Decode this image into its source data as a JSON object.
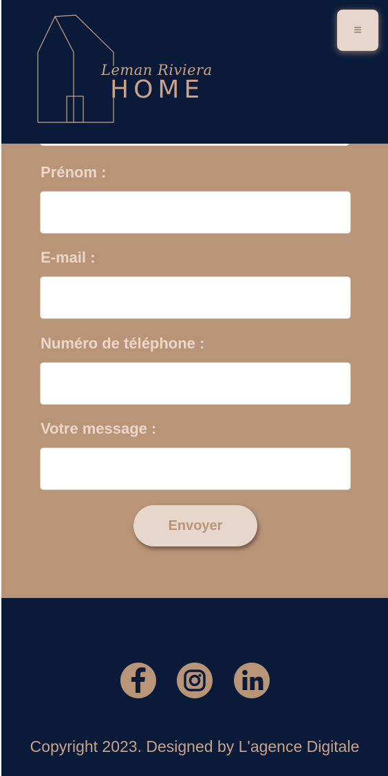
{
  "colors": {
    "navy": "#0a1b3a",
    "tan": "#b99578",
    "cream": "#e6d6cc",
    "label": "#ecd6ca",
    "gold": "#c9a288"
  },
  "header": {
    "logo_script": "Leman Riviera",
    "logo_word": "HOME",
    "menu_icon": "hamburger-icon",
    "menu_glyph": "≡"
  },
  "form": {
    "fields": [
      {
        "label": "Prénom :",
        "value": ""
      },
      {
        "label": "E-mail :",
        "value": ""
      },
      {
        "label": "Numéro de téléphone :",
        "value": ""
      },
      {
        "label": "Votre message :",
        "value": ""
      }
    ],
    "submit_label": "Envoyer"
  },
  "footer": {
    "social": [
      {
        "icon": "facebook-icon"
      },
      {
        "icon": "instagram-icon"
      },
      {
        "icon": "linkedin-icon"
      }
    ],
    "copyright": "Copyright 2023. Designed by L'agence Digitale"
  }
}
